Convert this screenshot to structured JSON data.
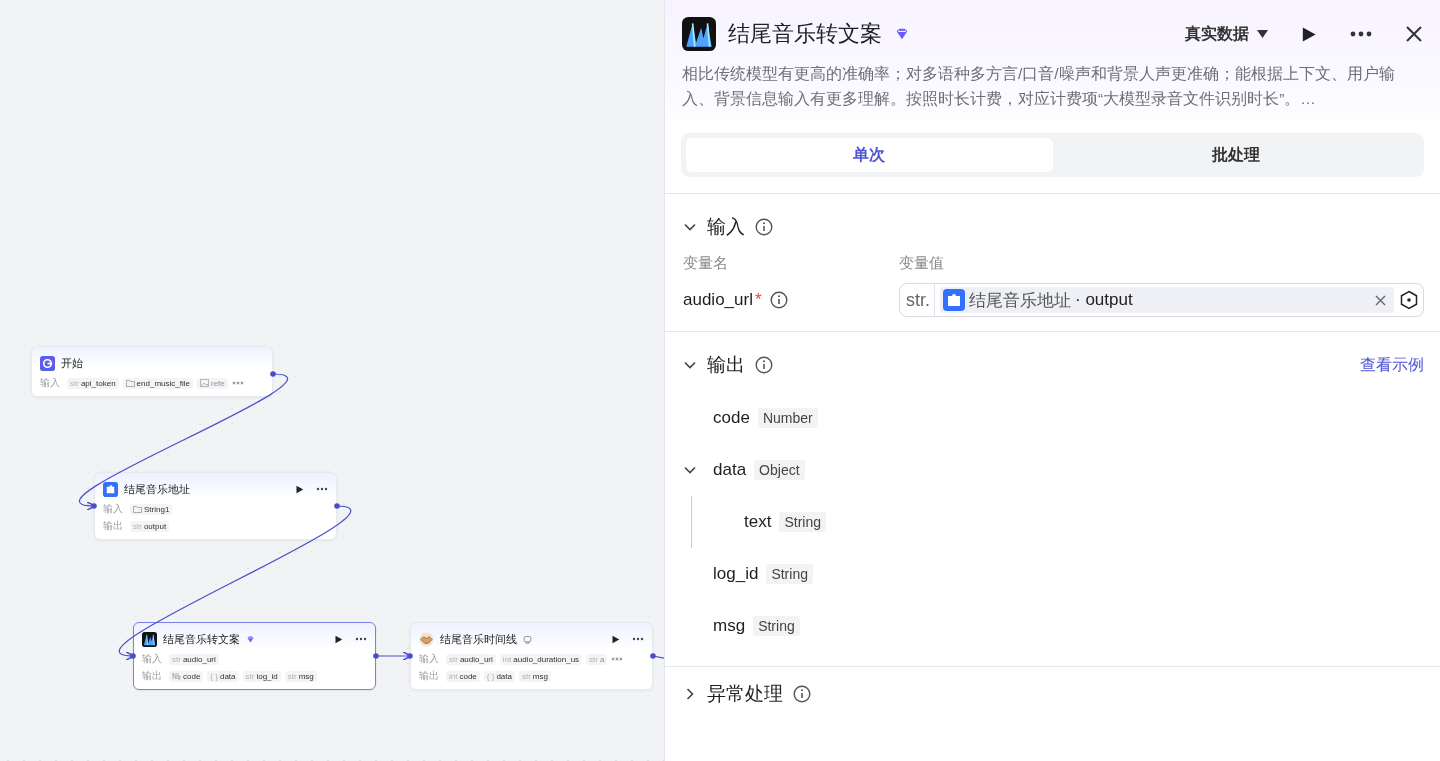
{
  "canvas": {
    "nodes": [
      {
        "title": "开始",
        "kind": "start",
        "premium": false,
        "chat_badge": false,
        "actions": false,
        "selected": false,
        "rows": [
          {
            "label": "输入",
            "more": true,
            "chips": [
              {
                "kind": "str",
                "prefix": "str",
                "name": "api_token",
                "faded": false
              },
              {
                "kind": "folder",
                "name": "end_music_file",
                "faded": false
              },
              {
                "kind": "image",
                "name": "refe",
                "faded": true
              }
            ]
          }
        ]
      },
      {
        "title": "结尾音乐地址",
        "kind": "plugin",
        "premium": false,
        "chat_badge": false,
        "actions": true,
        "selected": false,
        "rows": [
          {
            "label": "输入",
            "more": false,
            "chips": [
              {
                "kind": "folder",
                "name": "String1",
                "faded": false
              }
            ]
          },
          {
            "label": "输出",
            "more": false,
            "chips": [
              {
                "kind": "str",
                "prefix": "str",
                "name": "output",
                "faded": false
              }
            ]
          }
        ]
      },
      {
        "title": "结尾音乐转文案",
        "kind": "model",
        "premium": true,
        "chat_badge": false,
        "actions": true,
        "selected": true,
        "rows": [
          {
            "label": "输入",
            "more": false,
            "chips": [
              {
                "kind": "str",
                "prefix": "str",
                "name": "audio_url",
                "faded": false
              }
            ]
          },
          {
            "label": "输出",
            "more": false,
            "chips": [
              {
                "kind": "number",
                "name": "code",
                "faded": false
              },
              {
                "kind": "str",
                "prefix": "{ }",
                "name": "data",
                "faded": false
              },
              {
                "kind": "str",
                "prefix": "str",
                "name": "log_id",
                "faded": false
              },
              {
                "kind": "str",
                "prefix": "str",
                "name": "msg",
                "faded": false
              }
            ]
          }
        ]
      },
      {
        "title": "结尾音乐时间线",
        "kind": "tool",
        "premium": false,
        "chat_badge": true,
        "actions": true,
        "selected": false,
        "rows": [
          {
            "label": "输入",
            "more": true,
            "chips": [
              {
                "kind": "str",
                "prefix": "str",
                "name": "audio_url",
                "faded": false
              },
              {
                "kind": "str",
                "prefix": "int",
                "name": "audio_duration_us",
                "faded": false
              },
              {
                "kind": "str",
                "prefix": "str",
                "name": "a",
                "faded": true
              }
            ]
          },
          {
            "label": "输出",
            "more": false,
            "chips": [
              {
                "kind": "str",
                "prefix": "int",
                "name": "code",
                "faded": false
              },
              {
                "kind": "str",
                "prefix": "{ }",
                "name": "data",
                "faded": false
              },
              {
                "kind": "str",
                "prefix": "str",
                "name": "msg",
                "faded": false
              }
            ]
          }
        ]
      }
    ]
  },
  "panel": {
    "title": "结尾音乐转文案",
    "premium": true,
    "data_source": "真实数据",
    "description": "相比传统模型有更高的准确率；对多语种多方言/口音/噪声和背景人声更准确；能根据上下文、用户输入、背景信息输入有更多理解。按照时长计费，对应计费项“大模型录音文件识别时长”。…",
    "tabs": [
      {
        "label": "单次",
        "selected": true
      },
      {
        "label": "批处理",
        "selected": false
      }
    ],
    "input": {
      "title": "输入",
      "expanded": true,
      "columns": [
        "变量名",
        "变量值"
      ],
      "rows": [
        {
          "name": "audio_url",
          "required": true,
          "required_mark": "*",
          "type": "str.",
          "source": "结尾音乐地址",
          "field": "· output"
        }
      ]
    },
    "output": {
      "title": "输出",
      "expanded": true,
      "link": "查看示例",
      "items": [
        {
          "name": "code",
          "type": "Number"
        },
        {
          "name": "data",
          "type": "Object",
          "expanded": true,
          "children": [
            {
              "name": "text",
              "type": "String"
            }
          ]
        },
        {
          "name": "log_id",
          "type": "String"
        },
        {
          "name": "msg",
          "type": "String"
        }
      ]
    },
    "error": {
      "title": "异常处理",
      "expanded": false
    }
  }
}
